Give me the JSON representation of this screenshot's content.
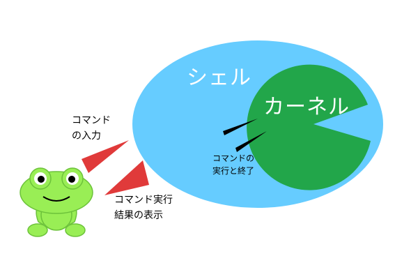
{
  "diagram": {
    "shell_label": "シェル",
    "kernel_label": "カーネル",
    "input_label": "コマンド\nの入力",
    "exec_label": "コマンドの\n実行と終了",
    "result_label": "コマンド実行\n結果の表示"
  },
  "colors": {
    "shell": "#66ccff",
    "kernel": "#22a64a",
    "arrow": "#e03a3a",
    "frog_body": "#99ee55",
    "frog_outline": "#6cc23a",
    "eye": "#ffffff",
    "pupil": "#000000"
  }
}
